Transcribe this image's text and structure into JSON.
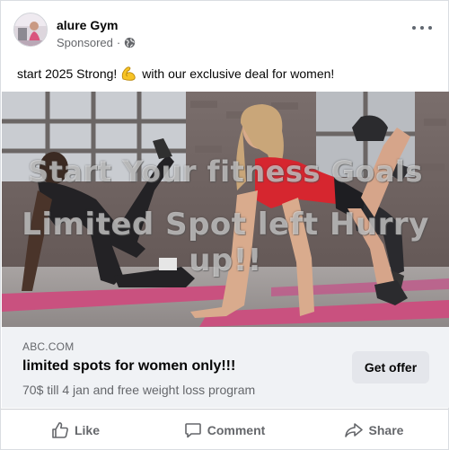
{
  "post": {
    "page_name": "alure Gym",
    "sponsored_label": "Sponsored",
    "separator": "·",
    "caption_before": "start 2025 Strong!",
    "caption_emoji": "flexed-biceps",
    "caption_after": "with our exclusive deal for women!"
  },
  "creative": {
    "overlay_line_1": "Start Your fitness Goals",
    "overlay_line_2": "Limited Spot left Hurry up!!"
  },
  "link": {
    "domain": "ABC.COM",
    "headline": "limited spots for women only!!!",
    "description": "70$ till 4 jan and free weight loss program",
    "cta_label": "Get offer"
  },
  "actions": {
    "like_label": "Like",
    "comment_label": "Comment",
    "share_label": "Share"
  },
  "colors": {
    "secondary_text": "#65676b",
    "link_box_bg": "#f0f2f5",
    "cta_bg": "#e4e6eb",
    "mat_pink": "#c9517f",
    "top_red": "#d6262f"
  },
  "icons": [
    "more-options-icon",
    "globe-icon",
    "flexed-biceps-emoji",
    "thumbs-up-icon",
    "comment-icon",
    "share-icon"
  ]
}
